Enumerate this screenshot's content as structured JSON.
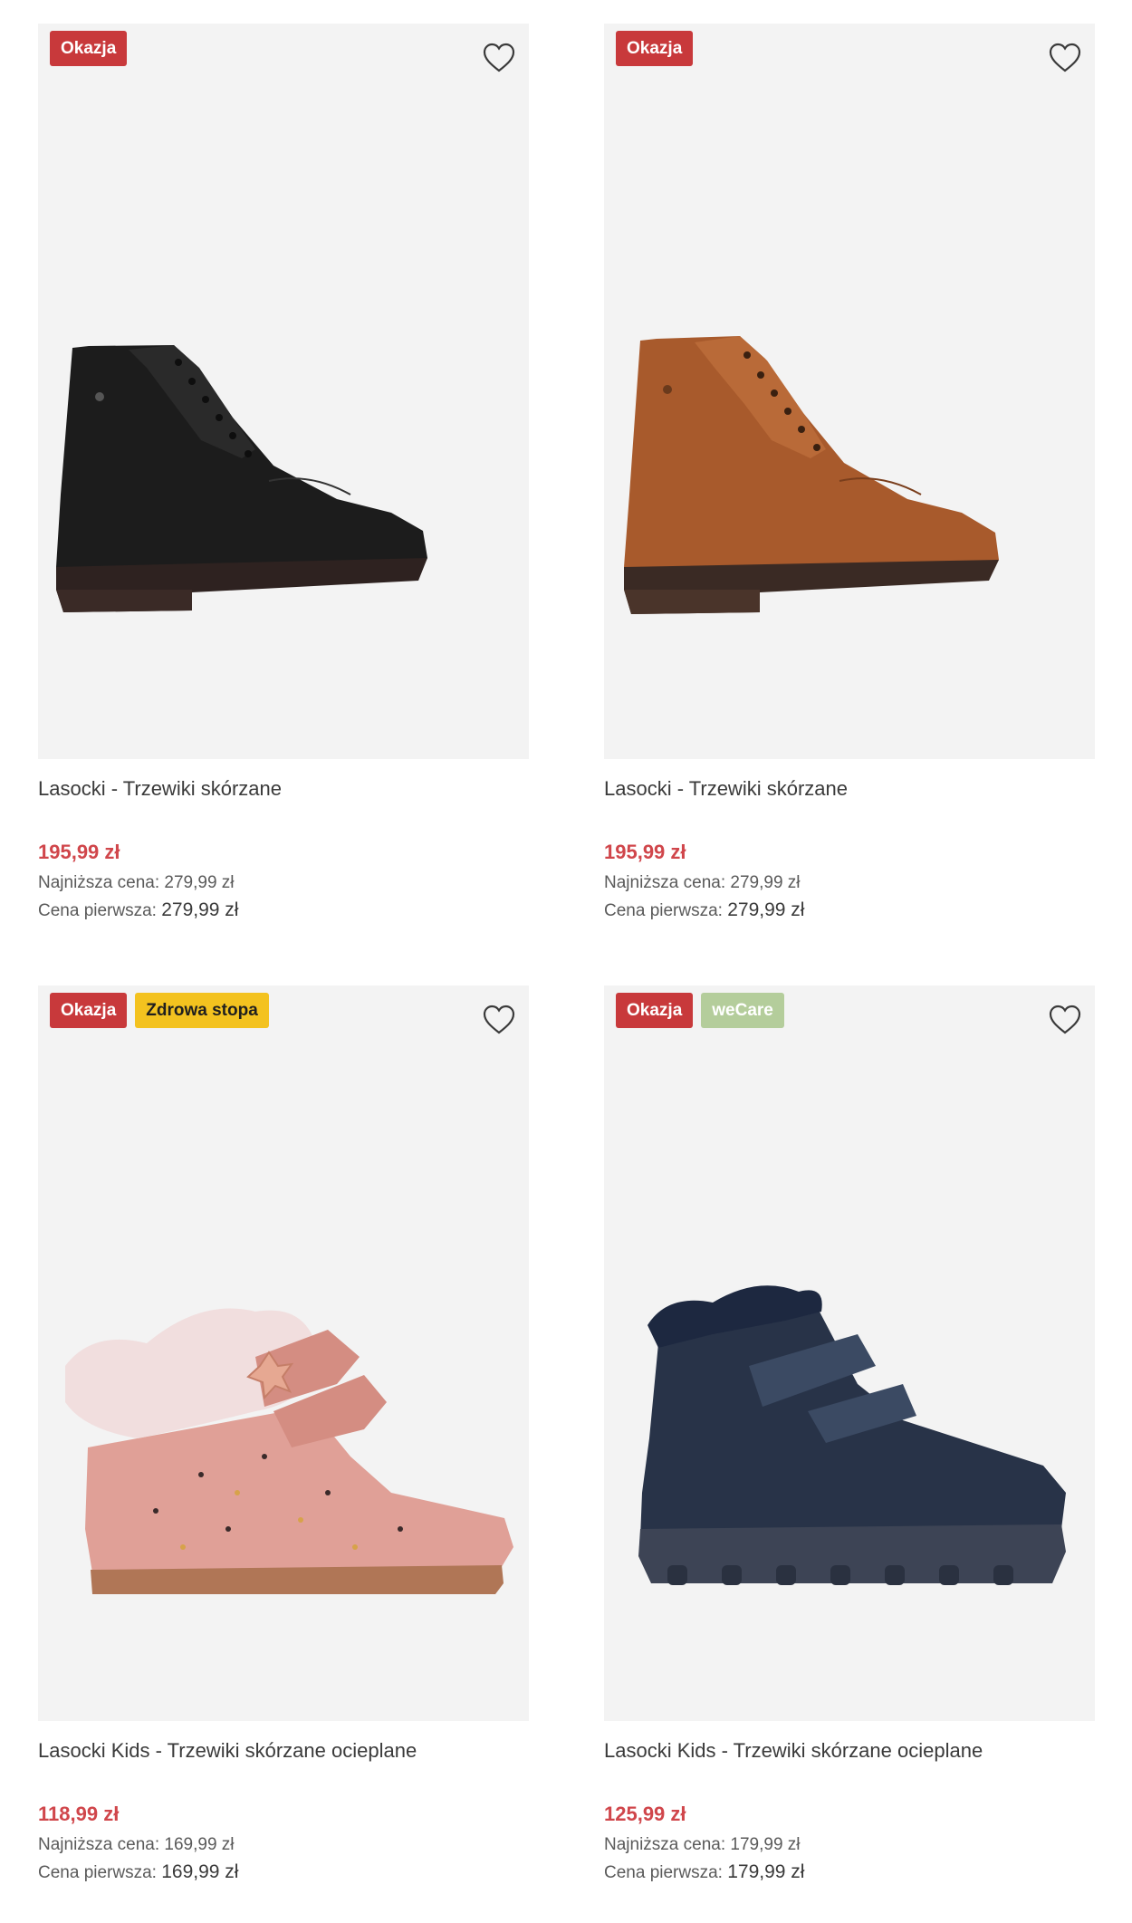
{
  "products": [
    {
      "badges": [
        "Okazja"
      ],
      "title": "Lasocki - Trzewiki skórzane",
      "price": "195,99 zł",
      "lowest_label": "Najniższa cena:",
      "lowest_value": "279,99 zł",
      "original_label": "Cena pierwsza:",
      "original_value": "279,99 zł",
      "shoe_color": "#1c1c1c"
    },
    {
      "badges": [
        "Okazja"
      ],
      "title": "Lasocki - Trzewiki skórzane",
      "price": "195,99 zł",
      "lowest_label": "Najniższa cena:",
      "lowest_value": "279,99 zł",
      "original_label": "Cena pierwsza:",
      "original_value": "279,99 zł",
      "shoe_color": "#a85a2c"
    },
    {
      "badges": [
        "Okazja",
        "Zdrowa stopa"
      ],
      "title": "Lasocki Kids - Trzewiki skórzane ocieplane",
      "price": "118,99 zł",
      "lowest_label": "Najniższa cena:",
      "lowest_value": "169,99 zł",
      "original_label": "Cena pierwsza:",
      "original_value": "169,99 zł",
      "shoe_color": "#e0a097"
    },
    {
      "badges": [
        "Okazja",
        "weCare"
      ],
      "title": "Lasocki Kids - Trzewiki skórzane ocieplane",
      "price": "125,99 zł",
      "lowest_label": "Najniższa cena:",
      "lowest_value": "179,99 zł",
      "original_label": "Cena pierwsza:",
      "original_value": "179,99 zł",
      "shoe_color": "#283348"
    }
  ],
  "icons": {
    "wishlist": "heart-outline-icon"
  },
  "colors": {
    "okazja": "#c8393b",
    "zdrowa_stopa": "#f3c21f",
    "wecare": "#b4cd9b",
    "price": "#d0464b"
  }
}
